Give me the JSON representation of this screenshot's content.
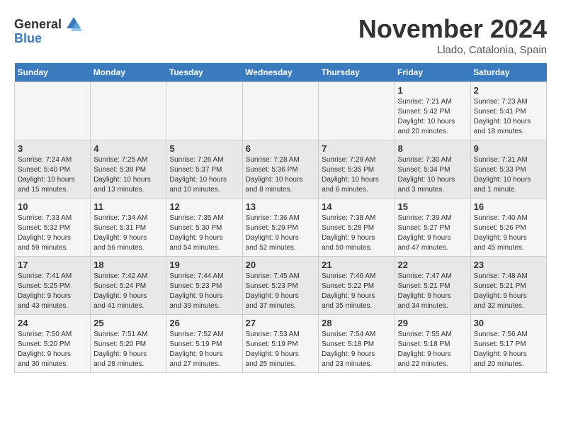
{
  "header": {
    "logo_line1": "General",
    "logo_line2": "Blue",
    "month": "November 2024",
    "location": "Llado, Catalonia, Spain"
  },
  "weekdays": [
    "Sunday",
    "Monday",
    "Tuesday",
    "Wednesday",
    "Thursday",
    "Friday",
    "Saturday"
  ],
  "weeks": [
    [
      {
        "day": "",
        "info": ""
      },
      {
        "day": "",
        "info": ""
      },
      {
        "day": "",
        "info": ""
      },
      {
        "day": "",
        "info": ""
      },
      {
        "day": "",
        "info": ""
      },
      {
        "day": "1",
        "info": "Sunrise: 7:21 AM\nSunset: 5:42 PM\nDaylight: 10 hours\nand 20 minutes."
      },
      {
        "day": "2",
        "info": "Sunrise: 7:23 AM\nSunset: 5:41 PM\nDaylight: 10 hours\nand 18 minutes."
      }
    ],
    [
      {
        "day": "3",
        "info": "Sunrise: 7:24 AM\nSunset: 5:40 PM\nDaylight: 10 hours\nand 15 minutes."
      },
      {
        "day": "4",
        "info": "Sunrise: 7:25 AM\nSunset: 5:38 PM\nDaylight: 10 hours\nand 13 minutes."
      },
      {
        "day": "5",
        "info": "Sunrise: 7:26 AM\nSunset: 5:37 PM\nDaylight: 10 hours\nand 10 minutes."
      },
      {
        "day": "6",
        "info": "Sunrise: 7:28 AM\nSunset: 5:36 PM\nDaylight: 10 hours\nand 8 minutes."
      },
      {
        "day": "7",
        "info": "Sunrise: 7:29 AM\nSunset: 5:35 PM\nDaylight: 10 hours\nand 6 minutes."
      },
      {
        "day": "8",
        "info": "Sunrise: 7:30 AM\nSunset: 5:34 PM\nDaylight: 10 hours\nand 3 minutes."
      },
      {
        "day": "9",
        "info": "Sunrise: 7:31 AM\nSunset: 5:33 PM\nDaylight: 10 hours\nand 1 minute."
      }
    ],
    [
      {
        "day": "10",
        "info": "Sunrise: 7:33 AM\nSunset: 5:32 PM\nDaylight: 9 hours\nand 59 minutes."
      },
      {
        "day": "11",
        "info": "Sunrise: 7:34 AM\nSunset: 5:31 PM\nDaylight: 9 hours\nand 56 minutes."
      },
      {
        "day": "12",
        "info": "Sunrise: 7:35 AM\nSunset: 5:30 PM\nDaylight: 9 hours\nand 54 minutes."
      },
      {
        "day": "13",
        "info": "Sunrise: 7:36 AM\nSunset: 5:29 PM\nDaylight: 9 hours\nand 52 minutes."
      },
      {
        "day": "14",
        "info": "Sunrise: 7:38 AM\nSunset: 5:28 PM\nDaylight: 9 hours\nand 50 minutes."
      },
      {
        "day": "15",
        "info": "Sunrise: 7:39 AM\nSunset: 5:27 PM\nDaylight: 9 hours\nand 47 minutes."
      },
      {
        "day": "16",
        "info": "Sunrise: 7:40 AM\nSunset: 5:26 PM\nDaylight: 9 hours\nand 45 minutes."
      }
    ],
    [
      {
        "day": "17",
        "info": "Sunrise: 7:41 AM\nSunset: 5:25 PM\nDaylight: 9 hours\nand 43 minutes."
      },
      {
        "day": "18",
        "info": "Sunrise: 7:42 AM\nSunset: 5:24 PM\nDaylight: 9 hours\nand 41 minutes."
      },
      {
        "day": "19",
        "info": "Sunrise: 7:44 AM\nSunset: 5:23 PM\nDaylight: 9 hours\nand 39 minutes."
      },
      {
        "day": "20",
        "info": "Sunrise: 7:45 AM\nSunset: 5:23 PM\nDaylight: 9 hours\nand 37 minutes."
      },
      {
        "day": "21",
        "info": "Sunrise: 7:46 AM\nSunset: 5:22 PM\nDaylight: 9 hours\nand 35 minutes."
      },
      {
        "day": "22",
        "info": "Sunrise: 7:47 AM\nSunset: 5:21 PM\nDaylight: 9 hours\nand 34 minutes."
      },
      {
        "day": "23",
        "info": "Sunrise: 7:48 AM\nSunset: 5:21 PM\nDaylight: 9 hours\nand 32 minutes."
      }
    ],
    [
      {
        "day": "24",
        "info": "Sunrise: 7:50 AM\nSunset: 5:20 PM\nDaylight: 9 hours\nand 30 minutes."
      },
      {
        "day": "25",
        "info": "Sunrise: 7:51 AM\nSunset: 5:20 PM\nDaylight: 9 hours\nand 28 minutes."
      },
      {
        "day": "26",
        "info": "Sunrise: 7:52 AM\nSunset: 5:19 PM\nDaylight: 9 hours\nand 27 minutes."
      },
      {
        "day": "27",
        "info": "Sunrise: 7:53 AM\nSunset: 5:19 PM\nDaylight: 9 hours\nand 25 minutes."
      },
      {
        "day": "28",
        "info": "Sunrise: 7:54 AM\nSunset: 5:18 PM\nDaylight: 9 hours\nand 23 minutes."
      },
      {
        "day": "29",
        "info": "Sunrise: 7:55 AM\nSunset: 5:18 PM\nDaylight: 9 hours\nand 22 minutes."
      },
      {
        "day": "30",
        "info": "Sunrise: 7:56 AM\nSunset: 5:17 PM\nDaylight: 9 hours\nand 20 minutes."
      }
    ]
  ]
}
